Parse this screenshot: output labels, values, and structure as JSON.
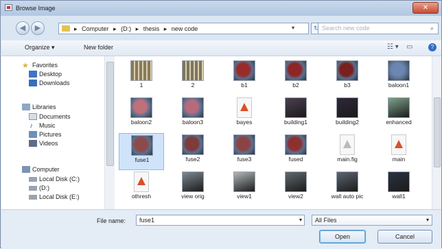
{
  "window": {
    "title": "Browse Image",
    "close_glyph": "✕"
  },
  "nav": {
    "back_glyph": "◀",
    "forward_glyph": "▶"
  },
  "address": {
    "crumbs": [
      "Computer",
      "(D:)",
      "thesis",
      "new code"
    ],
    "separator": "▸",
    "dropdown_glyph": "▾",
    "refresh_glyph": "↻"
  },
  "search": {
    "placeholder": "Search new code",
    "icon_glyph": "⌕"
  },
  "toolbar": {
    "organize": "Organize ▾",
    "new_folder": "New folder",
    "views_glyph": "☷ ▾",
    "preview_glyph": "▭",
    "help_glyph": "?"
  },
  "sidebar": {
    "favorites": {
      "label": "Favorites",
      "items": [
        "Desktop",
        "Downloads"
      ]
    },
    "libraries": {
      "label": "Libraries",
      "items": [
        "Documents",
        "Music",
        "Pictures",
        "Videos"
      ]
    },
    "computer": {
      "label": "Computer",
      "items": [
        "Local Disk (C:)",
        "(D:)",
        "Local Disk (E:)"
      ]
    }
  },
  "files": [
    {
      "name": "1",
      "icon": "building-photo-thumb",
      "color": "#8a7a5a"
    },
    {
      "name": "2",
      "icon": "building-photo-thumb",
      "color": "#7d7560"
    },
    {
      "name": "b1",
      "icon": "red-photo-thumb",
      "color": "#9a2b2b"
    },
    {
      "name": "b2",
      "icon": "red-photo-thumb",
      "color": "#8f2626"
    },
    {
      "name": "b3",
      "icon": "red-photo-thumb",
      "color": "#7a1f1f"
    },
    {
      "name": "baloon1",
      "icon": "balloon-photo-thumb",
      "color": "#6b86b0"
    },
    {
      "name": "baloon2",
      "icon": "balloon-photo-thumb",
      "color": "#c0707a"
    },
    {
      "name": "baloon3",
      "icon": "balloon-photo-thumb",
      "color": "#b76a7c"
    },
    {
      "name": "bayes",
      "icon": "matlab-file-icon",
      "color": "#e8e8e8"
    },
    {
      "name": "building1",
      "icon": "dusk-photo-thumb",
      "color": "#4c4050"
    },
    {
      "name": "building2",
      "icon": "dusk-photo-thumb",
      "color": "#2f2838"
    },
    {
      "name": "enhanced",
      "icon": "collage-photo-thumb",
      "color": "#7fa28a"
    },
    {
      "name": "fuse1",
      "icon": "red-photo-thumb",
      "color": "#8e4a4a",
      "selected": true
    },
    {
      "name": "fuse2",
      "icon": "red-photo-thumb",
      "color": "#7d3b3b"
    },
    {
      "name": "fuse3",
      "icon": "red-photo-thumb",
      "color": "#8b4444"
    },
    {
      "name": "fused",
      "icon": "red-photo-thumb",
      "color": "#8f3030"
    },
    {
      "name": "main.fig",
      "icon": "fig-file-icon",
      "color": "#e8e8e8"
    },
    {
      "name": "main",
      "icon": "matlab-file-icon",
      "color": "#e8e8e8"
    },
    {
      "name": "othresh",
      "icon": "matlab-file-icon",
      "color": "#e8e8e8"
    },
    {
      "name": "view orig",
      "icon": "landscape-photo-thumb",
      "color": "#7c8a92"
    },
    {
      "name": "view1",
      "icon": "landscape-photo-thumb",
      "color": "#b3b8ba"
    },
    {
      "name": "view2",
      "icon": "landscape-photo-thumb",
      "color": "#5f6a70"
    },
    {
      "name": "wall auto pic",
      "icon": "wall-photo-thumb",
      "color": "#5e6570"
    },
    {
      "name": "wall1",
      "icon": "wall-photo-thumb",
      "color": "#2b3340"
    }
  ],
  "footer": {
    "filename_label": "File name:",
    "filename_value": "fuse1",
    "filetype_value": "All Files",
    "open_label": "Open",
    "cancel_label": "Cancel"
  }
}
